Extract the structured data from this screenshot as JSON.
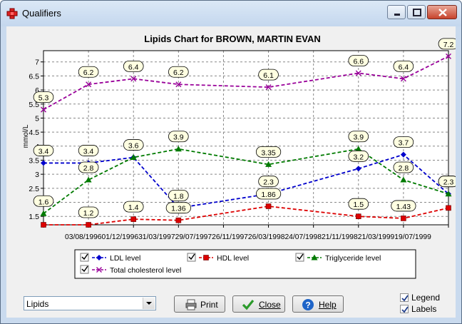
{
  "window": {
    "title": "Qualifiers"
  },
  "chart_data": {
    "type": "line",
    "title": "Lipids Chart for BROWN, MARTIN EVAN",
    "xlabel": "",
    "ylabel": "mmol/L",
    "ylim": [
      1.2,
      7.4
    ],
    "yticks": [
      "1.5",
      "2",
      "2.5",
      "3",
      "3.5",
      "4",
      "4.5",
      "5",
      "5.5",
      "6",
      "6.5",
      "7"
    ],
    "x_tick_text": "03/08/199601/12/199631/03/199729/07/199726/11/199726/03/199824/07/199821/11/199821/03/199919/07/1999",
    "categories": [
      "03/08/1996",
      "01/12/1996",
      "31/03/1997",
      "29/07/1997",
      "26/11/1997",
      "26/03/1998",
      "24/07/1998",
      "21/11/1998",
      "21/03/1999",
      "19/07/1999"
    ],
    "grid": true,
    "series": [
      {
        "name": "LDL level",
        "color": "#0000cc",
        "marker": "diamond",
        "dates": [
          "03/08/1996",
          "01/12/1996",
          "31/03/1997",
          "29/07/1997",
          "26/03/1998",
          "21/11/1998",
          "21/03/1999",
          "19/07/1999"
        ],
        "values": [
          3.4,
          3.4,
          3.6,
          1.8,
          2.3,
          3.2,
          3.7,
          2.3
        ],
        "labels": [
          "3.4",
          "3.4",
          "3.6",
          "1.8",
          "2.3",
          "3.2",
          "3.7",
          "2.3"
        ]
      },
      {
        "name": "HDL level",
        "color": "#dd0000",
        "marker": "square",
        "dates": [
          "03/08/1996",
          "01/12/1996",
          "31/03/1997",
          "29/07/1997",
          "26/03/1998",
          "21/11/1998",
          "21/03/1999",
          "19/07/1999"
        ],
        "values": [
          1.2,
          1.2,
          1.4,
          1.36,
          1.86,
          1.5,
          1.43,
          1.8
        ],
        "labels": [
          "",
          "1.2",
          "1.4",
          "1.36",
          "1.86",
          "1.5",
          "1.43",
          ""
        ]
      },
      {
        "name": "Triglyceride level",
        "color": "#007a00",
        "marker": "triangle",
        "dates": [
          "03/08/1996",
          "01/12/1996",
          "31/03/1997",
          "29/07/1997",
          "26/03/1998",
          "21/11/1998",
          "21/03/1999",
          "19/07/1999"
        ],
        "values": [
          1.6,
          2.8,
          3.6,
          3.9,
          3.35,
          3.9,
          2.8,
          2.3
        ],
        "labels": [
          "1.6",
          "2.8",
          "",
          "3.9",
          "3.35",
          "3.9",
          "2.8",
          "2.3"
        ]
      },
      {
        "name": "Total cholesterol level",
        "color": "#990099",
        "marker": "x",
        "dates": [
          "03/08/1996",
          "01/12/1996",
          "31/03/1997",
          "29/07/1997",
          "26/03/1998",
          "21/11/1998",
          "21/03/1999",
          "19/07/1999"
        ],
        "values": [
          5.3,
          6.2,
          6.4,
          6.2,
          6.1,
          6.6,
          6.4,
          7.2
        ],
        "labels": [
          "5.3",
          "6.2",
          "6.4",
          "6.2",
          "6.1",
          "6.6",
          "6.4",
          "7.2"
        ]
      }
    ]
  },
  "controls": {
    "chart_select": {
      "value": "Lipids"
    },
    "print_label": "Print",
    "close_label": "Close",
    "help_label": "Help",
    "legend_checkbox": {
      "label": "Legend",
      "checked": true
    },
    "labels_checkbox": {
      "label": "Labels",
      "checked": true
    }
  }
}
